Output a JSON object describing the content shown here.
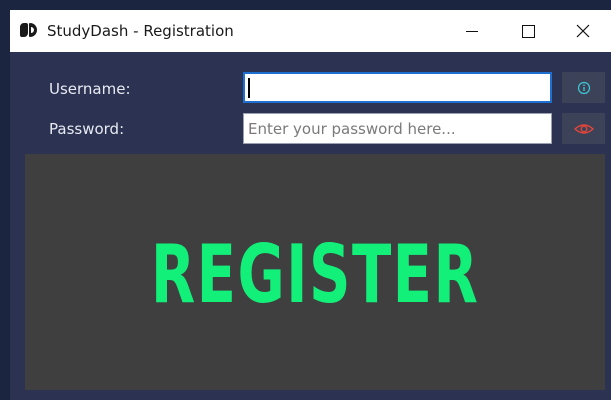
{
  "window": {
    "title": "StudyDash - Registration",
    "logo_icon": "studydash-logo-icon"
  },
  "form": {
    "username_label": "Username:",
    "username_value": "",
    "password_label": "Password:",
    "password_placeholder": "Enter your password here...",
    "info_icon": "info-icon",
    "eye_icon": "eye-icon"
  },
  "register": {
    "label": "REGISTER"
  },
  "colors": {
    "accent_green": "#12f07a",
    "window_bg": "#2b3252",
    "panel_bg": "#3f3f3f",
    "info_icon_color": "#3fc8d8",
    "eye_icon_color": "#e0453a"
  }
}
